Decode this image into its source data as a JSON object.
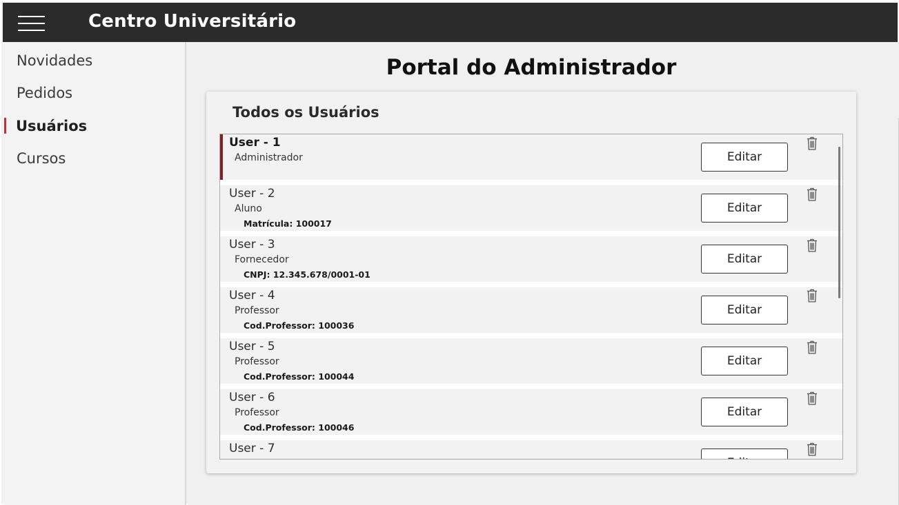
{
  "app": {
    "title": "Centro Universitário"
  },
  "sidebar": {
    "items": [
      {
        "label": "Novidades",
        "active": false
      },
      {
        "label": "Pedidos",
        "active": false
      },
      {
        "label": "Usuários",
        "active": true
      },
      {
        "label": "Cursos",
        "active": false
      }
    ]
  },
  "main": {
    "page_title": "Portal do Administrador",
    "card_title": "Todos os Usuários",
    "edit_label": "Editar",
    "users": [
      {
        "name": "User - 1",
        "role": "Administrador",
        "detail": ""
      },
      {
        "name": "User - 2",
        "role": "Aluno",
        "detail": "Matrícula: 100017"
      },
      {
        "name": "User - 3",
        "role": "Fornecedor",
        "detail": "CNPJ: 12.345.678/0001-01"
      },
      {
        "name": "User - 4",
        "role": "Professor",
        "detail": "Cod.Professor: 100036"
      },
      {
        "name": "User - 5",
        "role": "Professor",
        "detail": "Cod.Professor: 100044"
      },
      {
        "name": "User - 6",
        "role": "Professor",
        "detail": "Cod.Professor: 100046"
      },
      {
        "name": "User - 7",
        "role": "",
        "detail": ""
      }
    ]
  },
  "colors": {
    "topbar": "#2b2b2b",
    "active_indicator": "#b5333d",
    "selected_row_accent": "#7d2229",
    "background": "#f0f0f0"
  },
  "icons": {
    "menu": "hamburger-menu-icon",
    "delete": "trash-icon"
  }
}
